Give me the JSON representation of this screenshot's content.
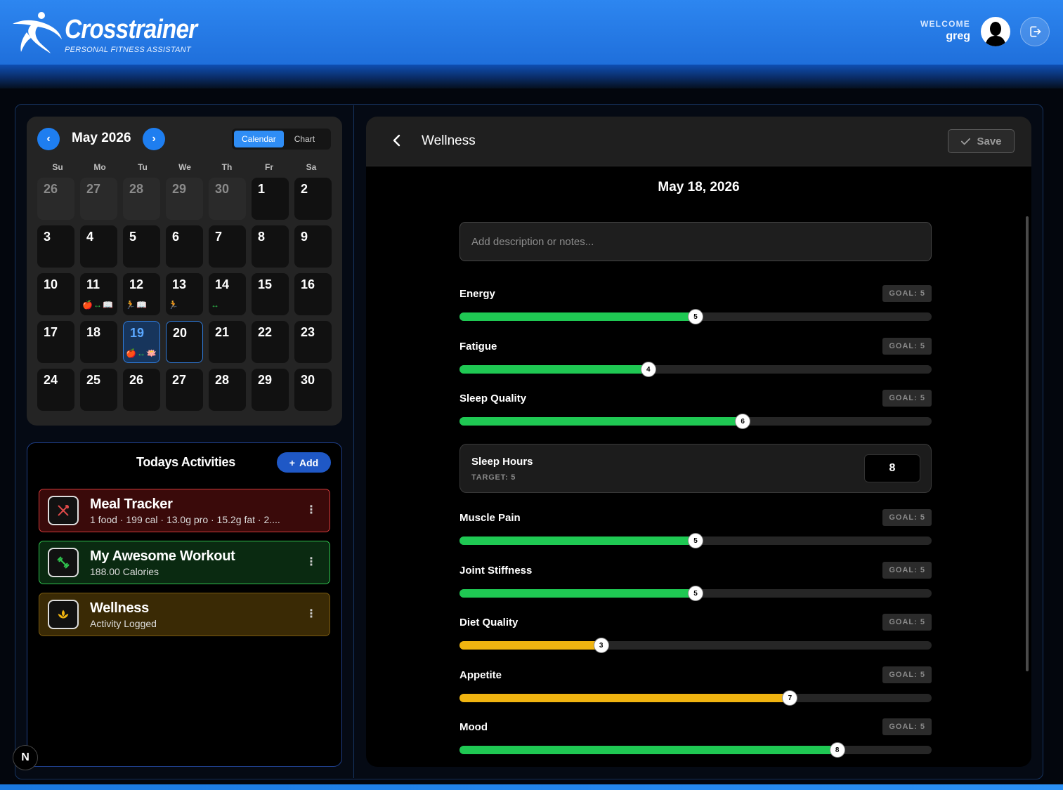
{
  "app": {
    "brand_name": "Crosstrainer",
    "brand_tagline": "PERSONAL FITNESS ASSISTANT",
    "welcome_label": "WELCOME",
    "username": "greg",
    "accent": "#2d86f0"
  },
  "calendar": {
    "month_label": "May 2026",
    "prev_icon": "‹",
    "next_icon": "›",
    "views": [
      "Calendar",
      "Chart"
    ],
    "active_view": "Calendar",
    "weekdays": [
      "Su",
      "Mo",
      "Tu",
      "We",
      "Th",
      "Fr",
      "Sa"
    ],
    "weeks": [
      [
        {
          "d": "26",
          "other": true
        },
        {
          "d": "27",
          "other": true
        },
        {
          "d": "28",
          "other": true
        },
        {
          "d": "29",
          "other": true
        },
        {
          "d": "30",
          "other": true
        },
        {
          "d": "1"
        },
        {
          "d": "2"
        }
      ],
      [
        {
          "d": "3"
        },
        {
          "d": "4"
        },
        {
          "d": "5"
        },
        {
          "d": "6"
        },
        {
          "d": "7"
        },
        {
          "d": "8"
        },
        {
          "d": "9"
        }
      ],
      [
        {
          "d": "10"
        },
        {
          "d": "11",
          "icons": [
            "apple",
            "dumbbell",
            "book"
          ]
        },
        {
          "d": "12",
          "icons": [
            "runner",
            "book"
          ]
        },
        {
          "d": "13",
          "icons": [
            "runner"
          ]
        },
        {
          "d": "14",
          "icons": [
            "dumbbell"
          ]
        },
        {
          "d": "15"
        },
        {
          "d": "16"
        }
      ],
      [
        {
          "d": "17"
        },
        {
          "d": "18"
        },
        {
          "d": "19",
          "today": true,
          "icons": [
            "apple",
            "dumbbell",
            "lotus"
          ]
        },
        {
          "d": "20",
          "selected": true
        },
        {
          "d": "21"
        },
        {
          "d": "22"
        },
        {
          "d": "23"
        }
      ],
      [
        {
          "d": "24"
        },
        {
          "d": "25"
        },
        {
          "d": "26"
        },
        {
          "d": "27"
        },
        {
          "d": "28"
        },
        {
          "d": "29"
        },
        {
          "d": "30"
        }
      ]
    ]
  },
  "activities": {
    "title": "Todays Activities",
    "add_label": "Add",
    "items": [
      {
        "name": "Meal Tracker",
        "subtitle": "1 food · 199 cal · 13.0g pro · 15.2g fat · 2....",
        "icon": "fork-knife-icon",
        "color": "#d23b3b"
      },
      {
        "name": "My Awesome Workout",
        "subtitle": "188.00 Calories",
        "icon": "dumbbell-icon",
        "color": "#2fc14d"
      },
      {
        "name": "Wellness",
        "subtitle": "Activity Logged",
        "icon": "lotus-icon",
        "color": "#7a5a10"
      }
    ]
  },
  "wellness": {
    "title": "Wellness",
    "save_label": "Save",
    "date": "May 18, 2026",
    "notes_placeholder": "Add description or notes...",
    "green": "#1fc853",
    "amber": "#f0b410",
    "metrics_top": [
      {
        "label": "Energy",
        "goal": "GOAL: 5",
        "value": 5,
        "color": "green"
      },
      {
        "label": "Fatigue",
        "goal": "GOAL: 5",
        "value": 4,
        "color": "green"
      },
      {
        "label": "Sleep Quality",
        "goal": "GOAL: 5",
        "value": 6,
        "color": "green"
      }
    ],
    "sleep": {
      "label": "Sleep Hours",
      "target": "TARGET: 5",
      "value": "8"
    },
    "metrics_bottom": [
      {
        "label": "Muscle Pain",
        "goal": "GOAL: 5",
        "value": 5,
        "color": "green"
      },
      {
        "label": "Joint Stiffness",
        "goal": "GOAL: 5",
        "value": 5,
        "color": "green"
      },
      {
        "label": "Diet Quality",
        "goal": "GOAL: 5",
        "value": 3,
        "color": "amber"
      },
      {
        "label": "Appetite",
        "goal": "GOAL: 5",
        "value": 7,
        "color": "amber"
      },
      {
        "label": "Mood",
        "goal": "GOAL: 5",
        "value": 8,
        "color": "green"
      }
    ],
    "scale_max": 10
  },
  "misc": {
    "next_badge": "N"
  }
}
